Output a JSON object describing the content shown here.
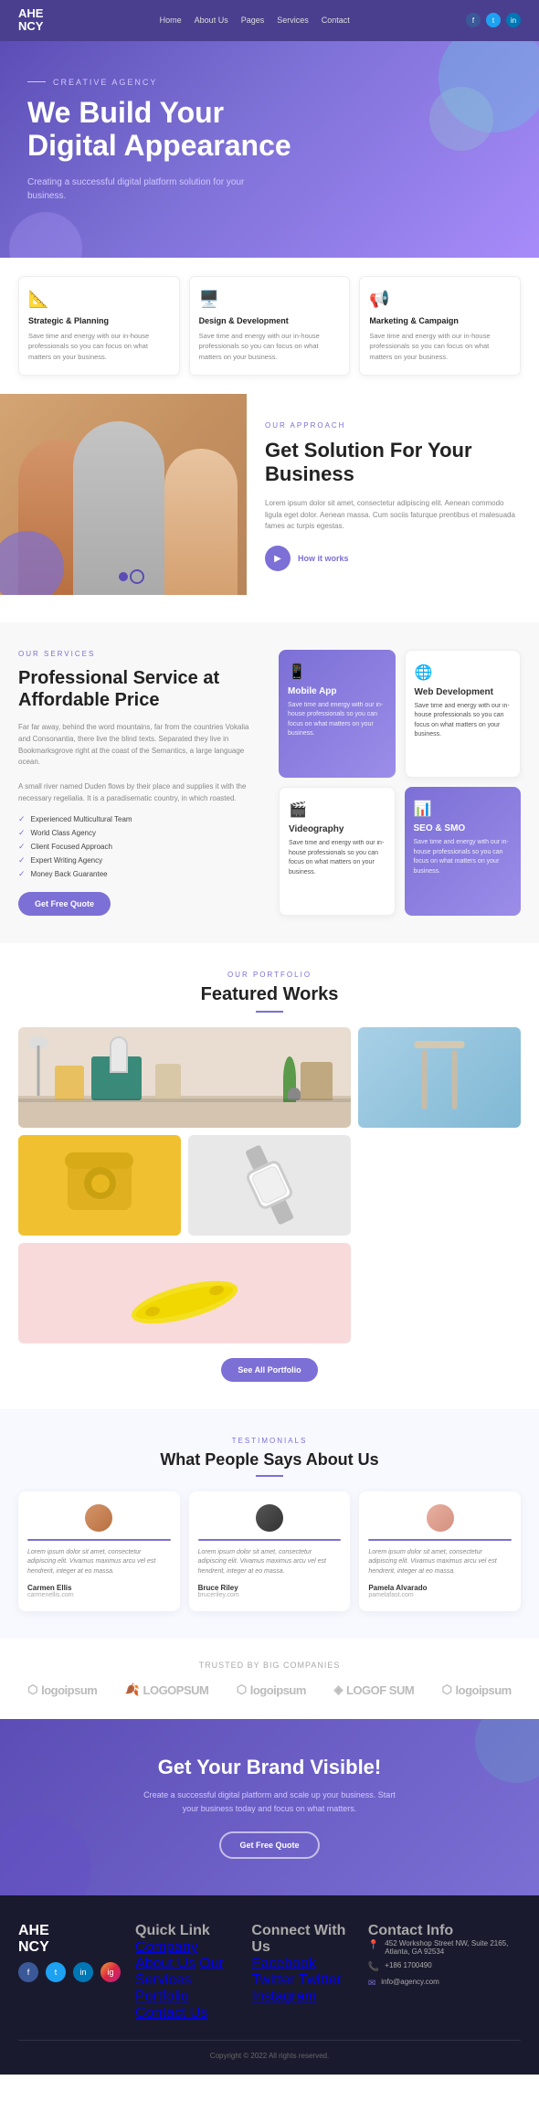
{
  "navbar": {
    "logo_line1": "AHE",
    "logo_line2": "NCY",
    "links": [
      "Home",
      "About Us",
      "Pages",
      "Services",
      "Contact"
    ],
    "social": [
      "f",
      "t",
      "in"
    ]
  },
  "hero": {
    "label": "Creative Agency",
    "title": "We Build Your Digital Appearance",
    "description": "Creating a successful digital platform solution for your business."
  },
  "services": {
    "label": "Our Services",
    "card1_title": "Strategic & Planning",
    "card1_desc": "Save time and energy with our in-house professionals so you can focus on what matters on your business.",
    "card2_title": "Design & Development",
    "card2_desc": "Save time and energy with our in-house professionals so you can focus on what matters on your business.",
    "card3_title": "Marketing & Campaign",
    "card3_desc": "Save time and energy with our in-house professionals so you can focus on what matters on your business."
  },
  "approach": {
    "label": "Our Approach",
    "title": "Get Solution For Your Business",
    "description": "Lorem ipsum dolor sit amet, consectetur adipiscing elit. Aenean commodo ligula eget dolor. Aenean massa. Cum sociis faturque prentibus et malesuada fames ac turpis egestas.",
    "play_label": "How it works"
  },
  "professional": {
    "label": "Our Services",
    "title": "Professional Service at Affordable Price",
    "description": "Far far away, behind the word mountains, far from the countries Vokalia and Consonantia, there live the blind texts. Separated they live in Bookmarksgrove right at the coast of the Semantics, a large language ocean.",
    "description2": "A small river named Duden flows by their place and supplies it with the necessary regelialia. It is a paradisematic country, in which roasted.",
    "list_items": [
      "Experienced Multicultural Team",
      "World Class Agency",
      "Client Focused Approach",
      "Expert Writing Agency",
      "Money Back Guarantee"
    ],
    "btn_label": "Get Free Quote",
    "tile1_title": "Mobile App",
    "tile1_desc": "Save time and energy with our in-house professionals so you can focus on what matters on your business.",
    "tile2_title": "Web Development",
    "tile2_desc": "Save time and energy with our in-house professionals so you can focus on what matters on your business.",
    "tile3_title": "Videography",
    "tile3_desc": "Save time and energy with our in-house professionals so you can focus on what matters on your business.",
    "tile4_title": "SEO & SMO",
    "tile4_desc": "Save time and energy with our in-house professionals so you can focus on what matters on your business."
  },
  "portfolio": {
    "label": "Our Portfolio",
    "title": "Featured Works",
    "see_all_label": "See All Portfolio"
  },
  "testimonials": {
    "label": "Testimonials",
    "title": "What People Says About Us",
    "t1_text": "Lorem ipsum dolor sit amet, consectetur adipiscing elit. Vivamus maximus arcu vel est hendrerit, integer at eo massa.",
    "t1_name": "Carmen Ellis",
    "t1_company": "carmenellis.com",
    "t2_text": "Lorem ipsum dolor sit amet, consectetur adipiscing elit. Vivamus maximus arcu vel est hendrerit, integer at eo massa.",
    "t2_name": "Bruce Riley",
    "t2_company": "bruceriley.com",
    "t3_text": "Lorem ipsum dolor sit amet, consectetur adipiscing elit. Vivamus maximus arcu vel est hendrerit, integer at eo massa.",
    "t3_name": "Pamela Alvarado",
    "t3_company": "pamelafast.com"
  },
  "trusted": {
    "label": "Trusted by big companies",
    "logos": [
      "logoipsum",
      "LOGOPSUM",
      "logoipsum",
      "LOGOF SUM",
      "logoipsum"
    ]
  },
  "cta": {
    "title": "Get Your Brand Visible!",
    "description": "Create a successful digital platform and scale up your business. Start your business today and focus on what matters.",
    "btn_label": "Get Free Quote"
  },
  "footer": {
    "logo_line1": "AHE",
    "logo_line2": "NCY",
    "quick_link_title": "Quick Link",
    "quick_links": [
      "Company",
      "About Us",
      "Our Services",
      "Portfolio",
      "Contact Us"
    ],
    "connect_title": "Connect With Us",
    "social_links": [
      "Facebook",
      "Twitter",
      "Twitter",
      "Instagram"
    ],
    "contact_title": "Contact Info",
    "address": "452 Workshop Street NW, Suite 2165, Atlanta, GA 92534",
    "phone": "+186 1700490",
    "email": "info@agency.com",
    "copyright": "Copyright © 2022 All rights reserved."
  },
  "colors": {
    "primary": "#7c6fd6",
    "dark": "#1a1a2e",
    "accent": "#5b4db5"
  }
}
